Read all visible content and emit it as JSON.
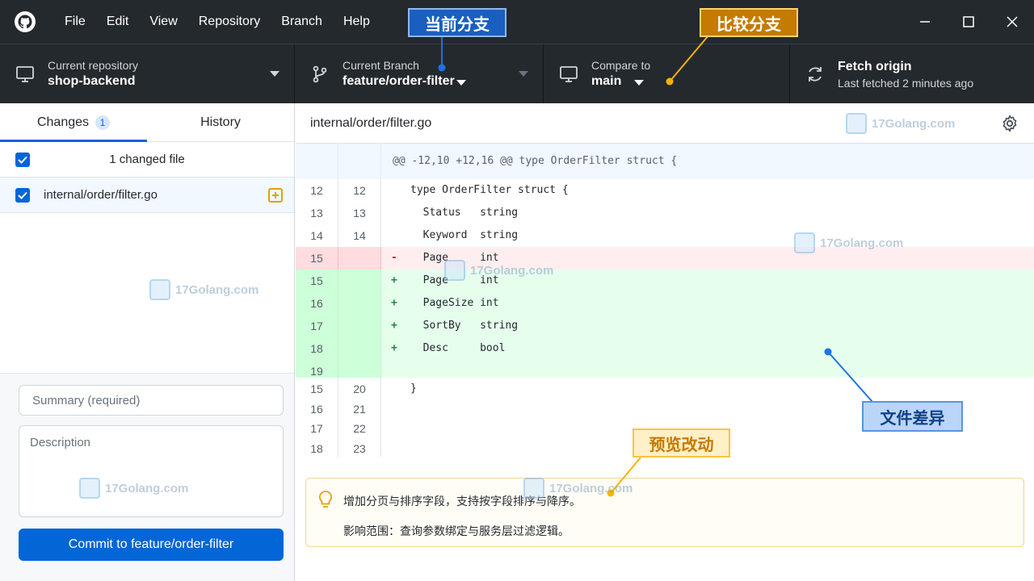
{
  "menu": [
    "File",
    "Edit",
    "View",
    "Repository",
    "Branch",
    "Help"
  ],
  "toolbar": {
    "repo": {
      "label": "Current repository",
      "value": "shop-backend"
    },
    "branch": {
      "label": "Current Branch",
      "value": "feature/order-filter"
    },
    "compare": {
      "label": "Compare to",
      "value": "main"
    },
    "fetch": {
      "label": "Fetch origin",
      "value": "Last fetched 2 minutes ago"
    }
  },
  "sidebar": {
    "tabs": [
      {
        "label": "Changes",
        "count": "1"
      },
      {
        "label": "History"
      }
    ],
    "changes_summary": "1 changed file",
    "files": [
      {
        "name": "internal/order/filter.go"
      }
    ]
  },
  "commit": {
    "summary_placeholder": "Summary (required)",
    "description_placeholder": "Description",
    "button_label": "Commit to feature/order-filter"
  },
  "diff": {
    "path": "internal/order/filter.go",
    "hunk": "@@ -12,10 +12,16 @@ type OrderFilter struct {",
    "lines": [
      {
        "type": "ctx",
        "old": "12",
        "new": "12",
        "marker": "",
        "text": "type OrderFilter struct {"
      },
      {
        "type": "ctx",
        "old": "13",
        "new": "13",
        "marker": "",
        "text": "  Status   string"
      },
      {
        "type": "ctx",
        "old": "14",
        "new": "14",
        "marker": "",
        "text": "  Keyword  string"
      },
      {
        "type": "del",
        "old": "15",
        "new": "",
        "marker": "-",
        "text": "  Page     int"
      },
      {
        "type": "add",
        "old": "15",
        "new": "",
        "marker": "+",
        "text": "  Page     int"
      },
      {
        "type": "add",
        "old": "16",
        "new": "",
        "marker": "+",
        "text": "  PageSize int"
      },
      {
        "type": "add",
        "old": "17",
        "new": "",
        "marker": "+",
        "text": "  SortBy   string"
      },
      {
        "type": "add",
        "old": "18",
        "new": "",
        "marker": "+",
        "text": "  Desc     bool"
      },
      {
        "type": "add",
        "old": "19",
        "new": "",
        "marker": "",
        "text": ""
      },
      {
        "type": "ctx",
        "old": "15",
        "new": "20",
        "marker": "",
        "text": "}"
      },
      {
        "type": "ctx",
        "old": "16",
        "new": "21",
        "marker": "",
        "text": ""
      },
      {
        "type": "ctx",
        "old": "17",
        "new": "22",
        "marker": "",
        "text": ""
      },
      {
        "type": "ctx",
        "old": "18",
        "new": "23",
        "marker": "",
        "text": ""
      }
    ]
  },
  "note": {
    "line1": "增加分页与排序字段，支持按字段排序与降序。",
    "line2": "影响范围：查询参数绑定与服务层过滤逻辑。"
  },
  "annotations": {
    "current_branch": "当前分支",
    "compare_branch": "比较分支",
    "file_diff": "文件差异",
    "preview_changes": "预览改动"
  },
  "watermark": {
    "text": "17Golang.com"
  },
  "colors": {
    "accent": "#0366d6",
    "titlebar": "#24292e",
    "added": "#e6ffed",
    "deleted": "#ffeef0"
  }
}
